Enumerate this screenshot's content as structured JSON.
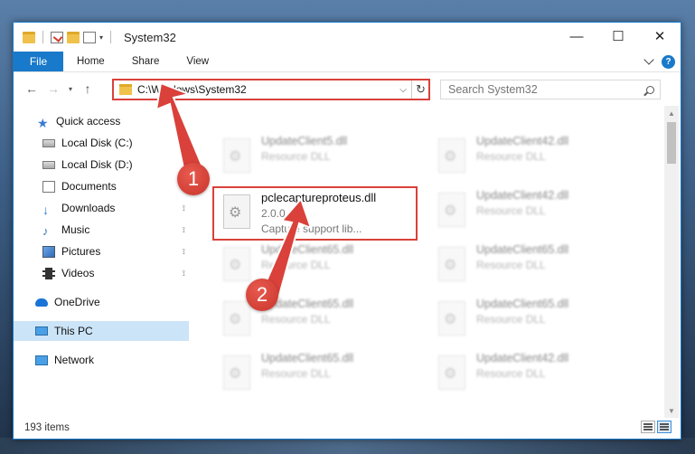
{
  "window": {
    "title": "System32",
    "controls": {
      "minimize": "—",
      "maximize": "☐",
      "close": "✕"
    }
  },
  "ribbon": {
    "tabs": [
      "File",
      "Home",
      "Share",
      "View"
    ],
    "help": "?"
  },
  "navbar": {
    "back": "←",
    "forward": "→",
    "recent": "▾",
    "up": "↑",
    "address": "C:\\Windows\\System32",
    "address_dropdown": "⌵",
    "refresh": "↻",
    "search_placeholder": "Search System32"
  },
  "sidebar": {
    "items": [
      {
        "label": "Quick access",
        "icon": "star-icon"
      },
      {
        "label": "Local Disk (C:)",
        "icon": "disk-icon",
        "pinned": true
      },
      {
        "label": "Local Disk (D:)",
        "icon": "disk-icon",
        "pinned": true
      },
      {
        "label": "Documents",
        "icon": "documents-icon",
        "pinned": true
      },
      {
        "label": "Downloads",
        "icon": "downloads-icon",
        "pinned": true
      },
      {
        "label": "Music",
        "icon": "music-icon",
        "pinned": true
      },
      {
        "label": "Pictures",
        "icon": "pictures-icon",
        "pinned": true
      },
      {
        "label": "Videos",
        "icon": "videos-icon",
        "pinned": true
      },
      {
        "label": "OneDrive",
        "icon": "onedrive-icon"
      },
      {
        "label": "This PC",
        "icon": "this-pc-icon",
        "selected": true
      },
      {
        "label": "Network",
        "icon": "network-icon"
      }
    ],
    "pin_glyph": "📌"
  },
  "files": {
    "left_column": [
      {
        "name": "UpdateClient5.dll",
        "sub": "Resource DLL"
      },
      {
        "name": "UpdateClient65.dll",
        "sub": "Resource DLL"
      },
      {
        "name": "UpdateClient65.dll",
        "sub": "Resource DLL"
      },
      {
        "name": "UpdateClient65.dll",
        "sub": "Resource DLL"
      }
    ],
    "right_column": [
      {
        "name": "UpdateClient42.dll",
        "sub": "Resource DLL"
      },
      {
        "name": "UpdateClient42.dll",
        "sub": "Resource DLL"
      },
      {
        "name": "UpdateClient65.dll",
        "sub": "Resource DLL"
      },
      {
        "name": "UpdateClient65.dll",
        "sub": "Resource DLL"
      },
      {
        "name": "UpdateClient42.dll",
        "sub": "Resource DLL"
      }
    ],
    "highlighted": {
      "name": "pclecaptureproteus.dll",
      "version": "2.0.0.17",
      "description": "Capture support lib..."
    }
  },
  "status": {
    "count": "193 items"
  },
  "annotations": {
    "marker1": "1",
    "marker2": "2",
    "color": "#d9413a"
  },
  "colors": {
    "accent": "#1979ca",
    "selection": "#cce4f7",
    "highlight": "#d9413a"
  }
}
